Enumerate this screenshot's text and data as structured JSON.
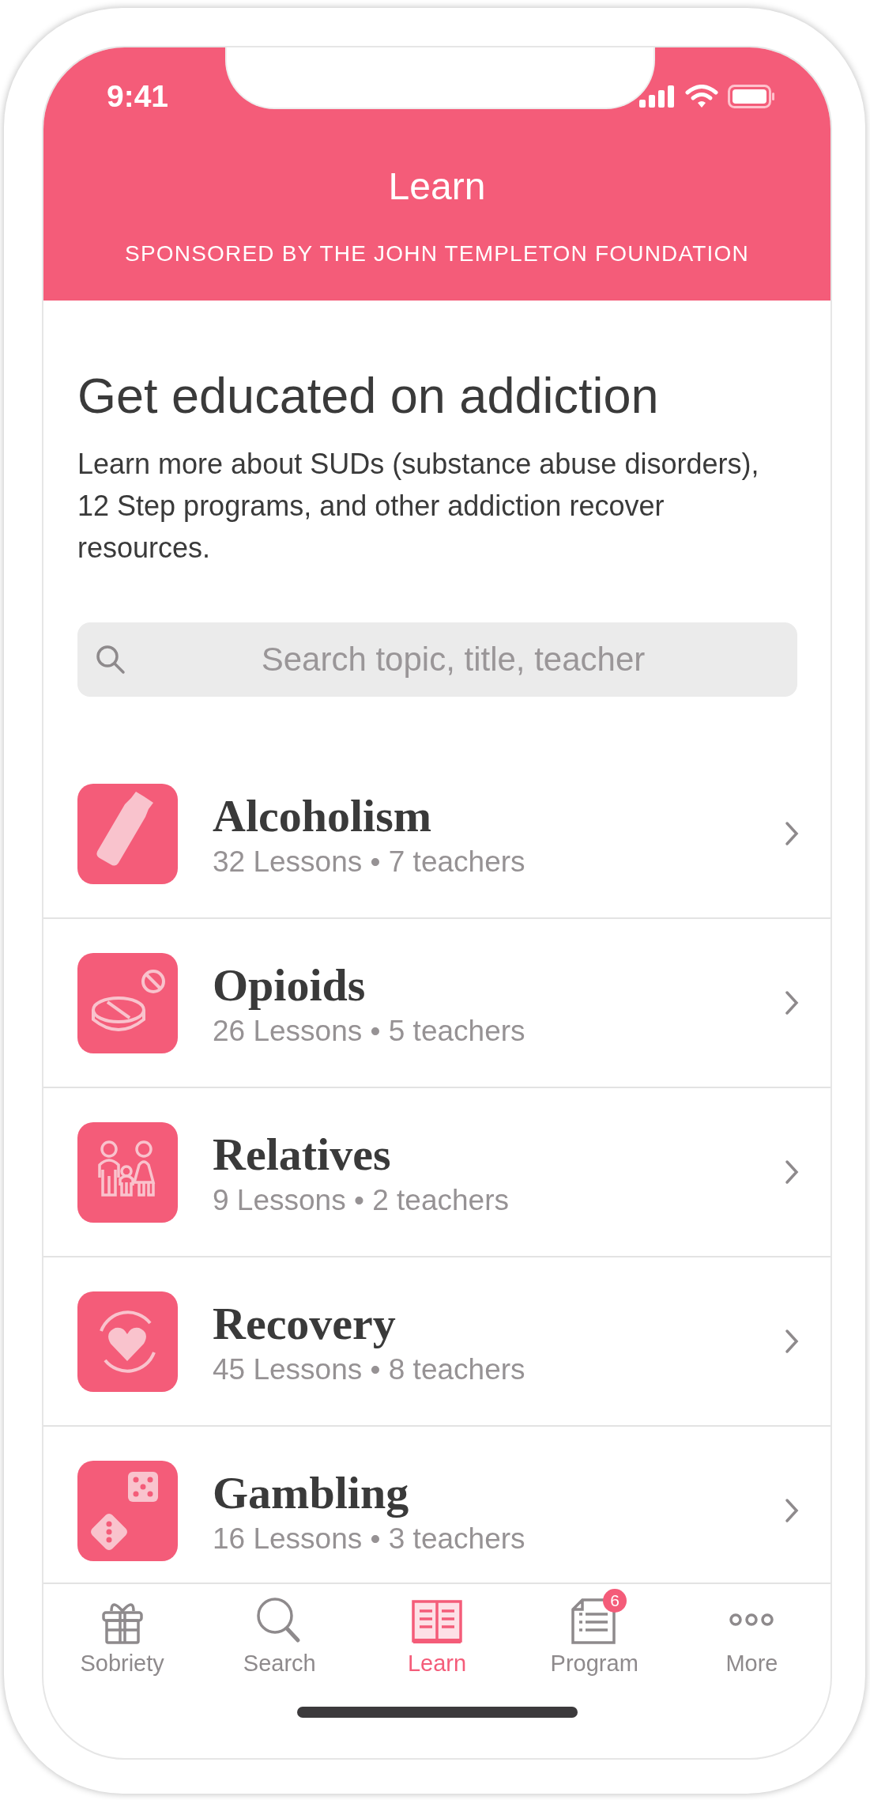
{
  "status_bar": {
    "time": "9:41"
  },
  "header": {
    "title": "Learn",
    "sponsor": "SPONSORED BY THE JOHN TEMPLETON FOUNDATION"
  },
  "intro": {
    "heading": "Get educated on addiction",
    "text": "Learn more about SUDs (substance abuse disorders), 12 Step programs, and other addiction recover resources."
  },
  "search": {
    "placeholder": "Search topic, title, teacher"
  },
  "topics": [
    {
      "title": "Alcoholism",
      "subtitle": "32 Lessons • 7 teachers"
    },
    {
      "title": "Opioids",
      "subtitle": "26 Lessons • 5 teachers"
    },
    {
      "title": "Relatives",
      "subtitle": "9 Lessons • 2 teachers"
    },
    {
      "title": "Recovery",
      "subtitle": "45 Lessons • 8 teachers"
    },
    {
      "title": "Gambling",
      "subtitle": "16 Lessons • 3 teachers"
    }
  ],
  "tab_bar": [
    {
      "label": "Sobriety",
      "selected": false
    },
    {
      "label": "Search",
      "selected": false
    },
    {
      "label": "Learn",
      "selected": true
    },
    {
      "label": "Program",
      "selected": false,
      "badge": "6"
    },
    {
      "label": "More",
      "selected": false
    }
  ]
}
